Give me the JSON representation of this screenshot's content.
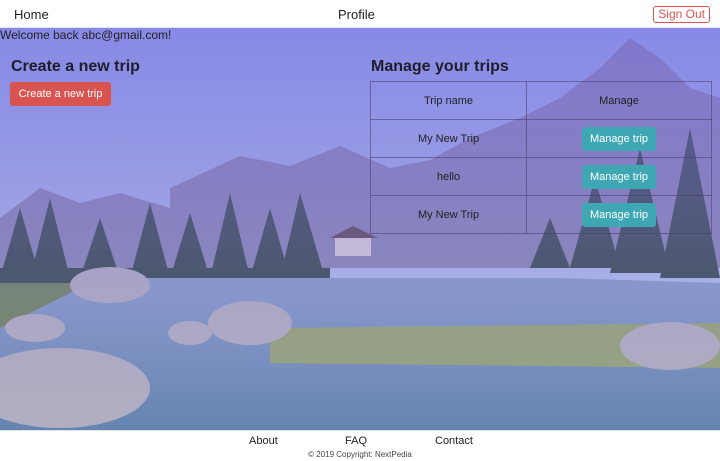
{
  "nav": {
    "home": "Home",
    "profile": "Profile",
    "signout": "Sign Out"
  },
  "welcome": "Welcome back abc@gmail.com!",
  "create": {
    "title": "Create a new trip",
    "button": "Create a new trip"
  },
  "manage": {
    "title": "Manage your trips",
    "headers": {
      "name": "Trip name",
      "manage": "Manage"
    },
    "rows": [
      {
        "name": "My New Trip",
        "action": "Manage trip"
      },
      {
        "name": "hello",
        "action": "Manage trip"
      },
      {
        "name": "My New Trip",
        "action": "Manage trip"
      }
    ]
  },
  "footer": {
    "about": "About",
    "faq": "FAQ",
    "contact": "Contact",
    "copyright": "© 2019 Copyright: NextPedia"
  },
  "colors": {
    "danger": "#d9534f",
    "info": "#3fa7b4",
    "overlay": "#7864e6"
  }
}
